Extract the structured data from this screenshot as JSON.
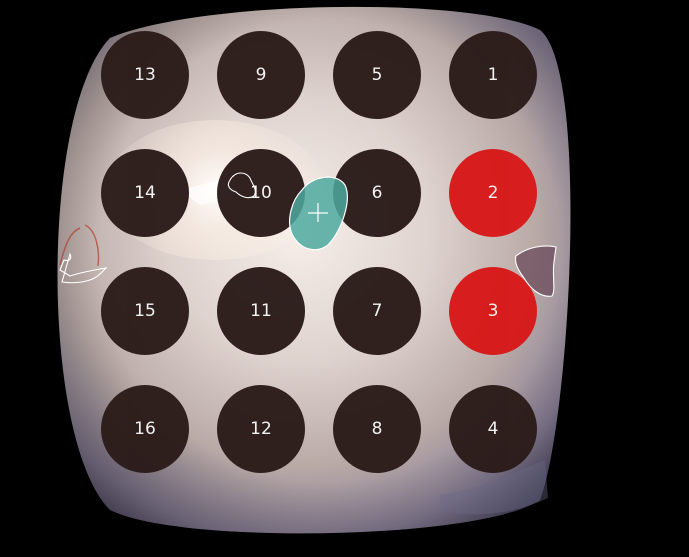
{
  "wells": [
    {
      "label": "13",
      "state": "empty"
    },
    {
      "label": "9",
      "state": "empty"
    },
    {
      "label": "5",
      "state": "empty"
    },
    {
      "label": "1",
      "state": "empty"
    },
    {
      "label": "14",
      "state": "empty"
    },
    {
      "label": "10",
      "state": "empty"
    },
    {
      "label": "6",
      "state": "empty"
    },
    {
      "label": "2",
      "state": "selected"
    },
    {
      "label": "15",
      "state": "empty"
    },
    {
      "label": "11",
      "state": "empty"
    },
    {
      "label": "7",
      "state": "empty"
    },
    {
      "label": "3",
      "state": "selected"
    },
    {
      "label": "16",
      "state": "empty"
    },
    {
      "label": "12",
      "state": "empty"
    },
    {
      "label": "8",
      "state": "empty"
    },
    {
      "label": "4",
      "state": "empty"
    }
  ],
  "colors": {
    "background": "#000000",
    "plate": "#c9b9b4",
    "well_fill": "#2b1c1a",
    "selected_fill": "#d81515",
    "label": "#f4f4f4",
    "highlight_object": "#4ea9a0",
    "outline": "#ffffff"
  },
  "icons": {
    "crosshair": "crosshair-icon"
  }
}
